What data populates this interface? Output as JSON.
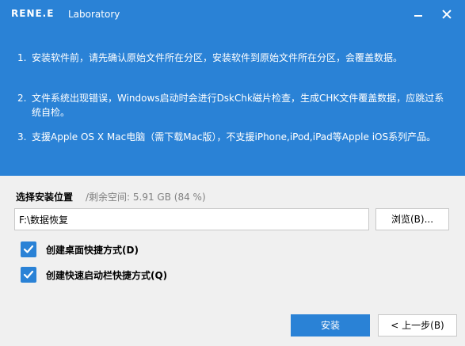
{
  "header": {
    "logo_text": "RENE.E",
    "brand_sub": "Laboratory"
  },
  "notes": [
    {
      "num": "1.",
      "text": "安装软件前，请先确认原始文件所在分区，安装软件到原始文件所在分区，会覆盖数据。"
    },
    {
      "num": "2.",
      "text": "文件系统出现错误，Windows启动时会进行DskChk磁片检查，生成CHK文件覆盖数据，应跳过系统自检。"
    },
    {
      "num": "3.",
      "text": "支援Apple OS X Mac电脑（需下载Mac版），不支援iPhone,iPod,iPad等Apple iOS系列产品。"
    }
  ],
  "install": {
    "location_label": "选择安装位置",
    "free_space": "/剩余空间: 5.91 GB (84 %)",
    "path_value": "F:\\数据恢复",
    "browse_label": "浏览(B)..."
  },
  "options": [
    {
      "label": "创建桌面快捷方式(D)",
      "checked": true
    },
    {
      "label": "创建快速启动栏快捷方式(Q)",
      "checked": true
    }
  ],
  "footer": {
    "install_label": "安装",
    "back_label": "< 上一步(B)"
  },
  "colors": {
    "accent": "#2a82d6",
    "panel_text": "#ffffff",
    "muted_text": "#808080"
  },
  "icons": {
    "minimize": "minimize-icon",
    "close": "close-icon",
    "checkmark": "checkmark-icon"
  }
}
